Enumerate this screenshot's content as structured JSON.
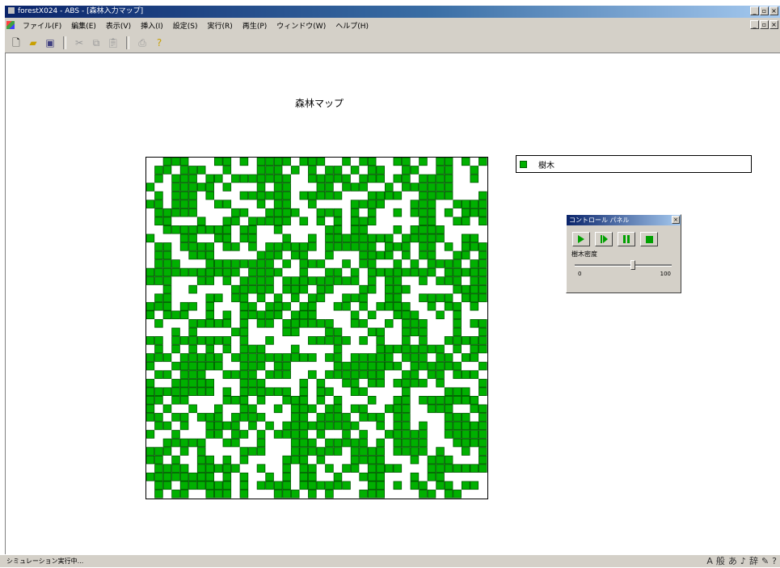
{
  "window": {
    "title": "forestX024 - ABS - [森林入力マップ]",
    "min_label": "_",
    "max_label": "▫",
    "close_label": "×"
  },
  "menu": {
    "items": [
      "ファイル(F)",
      "編集(E)",
      "表示(V)",
      "挿入(I)",
      "設定(S)",
      "実行(R)",
      "再生(P)",
      "ウィンドウ(W)",
      "ヘルプ(H)"
    ]
  },
  "toolbar": {
    "icons": [
      "new-file-icon",
      "open-folder-icon",
      "save-icon",
      "cut-icon",
      "copy-icon",
      "paste-icon",
      "print-icon",
      "help-icon"
    ]
  },
  "map": {
    "title": "森林マップ",
    "rows": 40,
    "cols": 40,
    "tree_color": "#00b000",
    "tree_border_color": "#005a00",
    "tree_density": 0.6
  },
  "legend": {
    "label": "樹木",
    "color": "#00b000"
  },
  "control_panel": {
    "title": "コントロール パネル",
    "close_label": "×",
    "slider_label": "樹木密度",
    "slider_min": "0",
    "slider_max": "100",
    "slider_value": 60
  },
  "status": {
    "text": "シミュレーション実行中..."
  },
  "tray": {
    "icons": [
      "input-method-icon",
      "keyboard-icon",
      "ime-icon",
      "dictionary-icon",
      "tool-icon",
      "help-icon",
      "caps-icon"
    ],
    "glyphs": [
      "A",
      "般",
      "あ",
      "♪",
      "辞",
      "✎",
      "?"
    ]
  }
}
